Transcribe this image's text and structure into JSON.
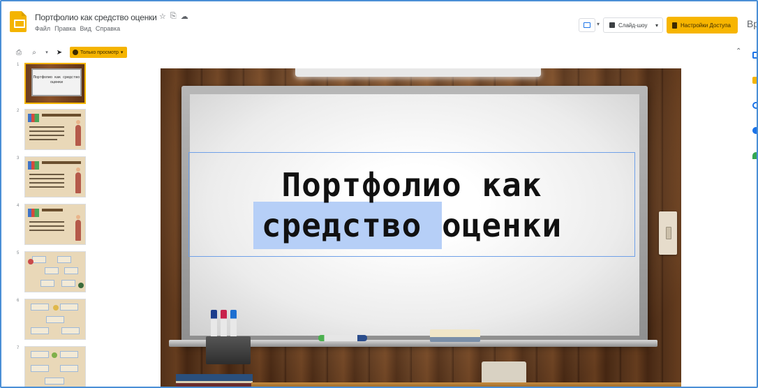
{
  "header": {
    "doc_title": "Портфолио как средство оценки",
    "title_icons": [
      "star-icon",
      "move-to-folder-icon",
      "cloud-status-icon"
    ],
    "menus": [
      "Файл",
      "Правка",
      "Вид",
      "Справка"
    ],
    "slideshow_label": "Слайд-шоу",
    "share_label": "Настройки Доступа",
    "avatar_partial": "Вр",
    "accent_color": "#f4b400"
  },
  "toolbar": {
    "view_mode_label": "Только просмотр",
    "icons": [
      "print-icon",
      "zoom-icon",
      "select-cursor-icon"
    ]
  },
  "filmstrip": {
    "slides": [
      {
        "number": "1",
        "title": "Портфолио как средство оценки"
      },
      {
        "number": "2",
        "title": "Что такое портфолио?"
      },
      {
        "number": "3",
        "title": "Особенности портфолио как средства оценки"
      },
      {
        "number": "4",
        "title": "Цель портфолио"
      },
      {
        "number": "5",
        "title": ""
      },
      {
        "number": "6",
        "title": ""
      },
      {
        "number": "7",
        "title": ""
      }
    ],
    "active_index": 0
  },
  "slide": {
    "title_line1": "Портфолио как",
    "title_line2": "средство оценки",
    "selected_word": "средство"
  }
}
